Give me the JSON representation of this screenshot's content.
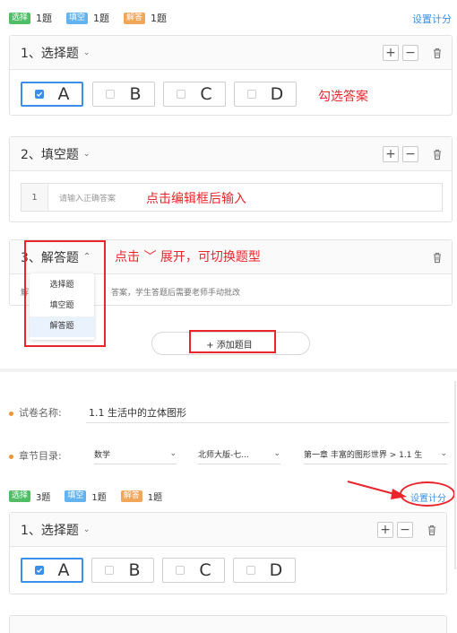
{
  "top_summary": {
    "items": [
      {
        "tag": "选择",
        "count": "1题",
        "color": "#4fbf67"
      },
      {
        "tag": "填空",
        "count": "1题",
        "color": "#63b3f0"
      },
      {
        "tag": "解答",
        "count": "1题",
        "color": "#f2a65a"
      }
    ],
    "score_link": "设置计分"
  },
  "question1": {
    "title": "1、选择题",
    "options": [
      "A",
      "B",
      "C",
      "D"
    ],
    "selected": "A",
    "note": "勾选答案"
  },
  "question2": {
    "title": "2、填空题",
    "row_index": "1",
    "placeholder": "请输入正确答案",
    "note": "点击编辑框后输入"
  },
  "question3": {
    "title_prefix": "3、",
    "title": "解答题",
    "note": "点击 ﹀ 展开，可切换题型",
    "desc_prefix": "解",
    "desc_suffix": "答案，学生答题后需要老师手动批改",
    "dropdown": [
      "选择题",
      "填空题",
      "解答题"
    ],
    "dropdown_selected": "解答题"
  },
  "add_button": "+ 添加题目",
  "form": {
    "name_label": "试卷名称:",
    "name_value": "1.1 生活中的立体图形",
    "chapter_label": "章节目录:",
    "subject": "数学",
    "edition": "北师大版-七...",
    "chapter": "第一章 丰富的图形世界 > 1.1 生"
  },
  "bottom_summary": {
    "items": [
      {
        "tag": "选择",
        "count": "3题",
        "color": "#4fbf67"
      },
      {
        "tag": "填空",
        "count": "1题",
        "color": "#63b3f0"
      },
      {
        "tag": "解答",
        "count": "1题",
        "color": "#f2a65a"
      }
    ],
    "score_link": "设置计分"
  },
  "question_bottom": {
    "title": "1、选择题",
    "options": [
      "A",
      "B",
      "C",
      "D"
    ],
    "selected": "A"
  }
}
